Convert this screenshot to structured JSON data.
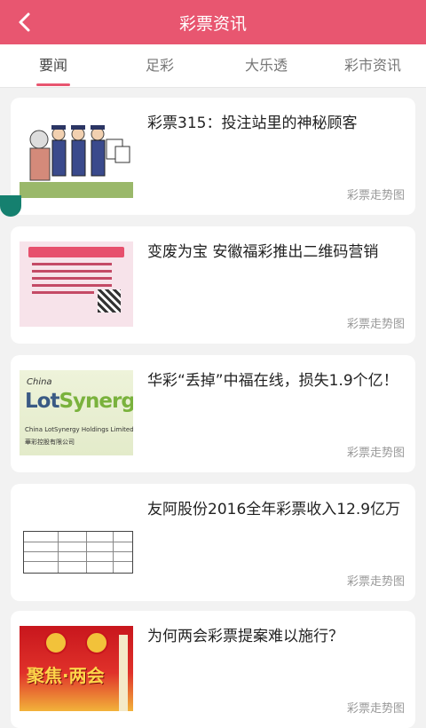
{
  "header": {
    "title": "彩票资讯",
    "back_icon": "back-arrow-icon"
  },
  "tabs": [
    {
      "label": "要闻",
      "active": true
    },
    {
      "label": "足彩",
      "active": false
    },
    {
      "label": "大乐透",
      "active": false
    },
    {
      "label": "彩市资讯",
      "active": false
    }
  ],
  "articles": [
    {
      "title": "彩票315：投注站里的神秘顾客",
      "tag": "彩票走势图"
    },
    {
      "title": "变废为宝 安徽福彩推出二维码营销",
      "tag": "彩票走势图"
    },
    {
      "title": "华彩“丢掉”中福在线，损失1.9个亿！",
      "tag": "彩票走势图",
      "thumb": {
        "line1": "China",
        "logo_a": "Lot",
        "logo_b": "Synergy",
        "line2": "China LotSynergy Holdings Limited",
        "line3": "華彩控股有限公司"
      }
    },
    {
      "title": "友阿股份2016全年彩票收入12.9亿万",
      "tag": "彩票走势图"
    },
    {
      "title": "为何两会彩票提案难以施行？",
      "tag": "彩票走势图",
      "thumb": {
        "text": "聚焦·两会"
      }
    }
  ],
  "colors": {
    "accent": "#e85670",
    "fab": "#15806f"
  }
}
